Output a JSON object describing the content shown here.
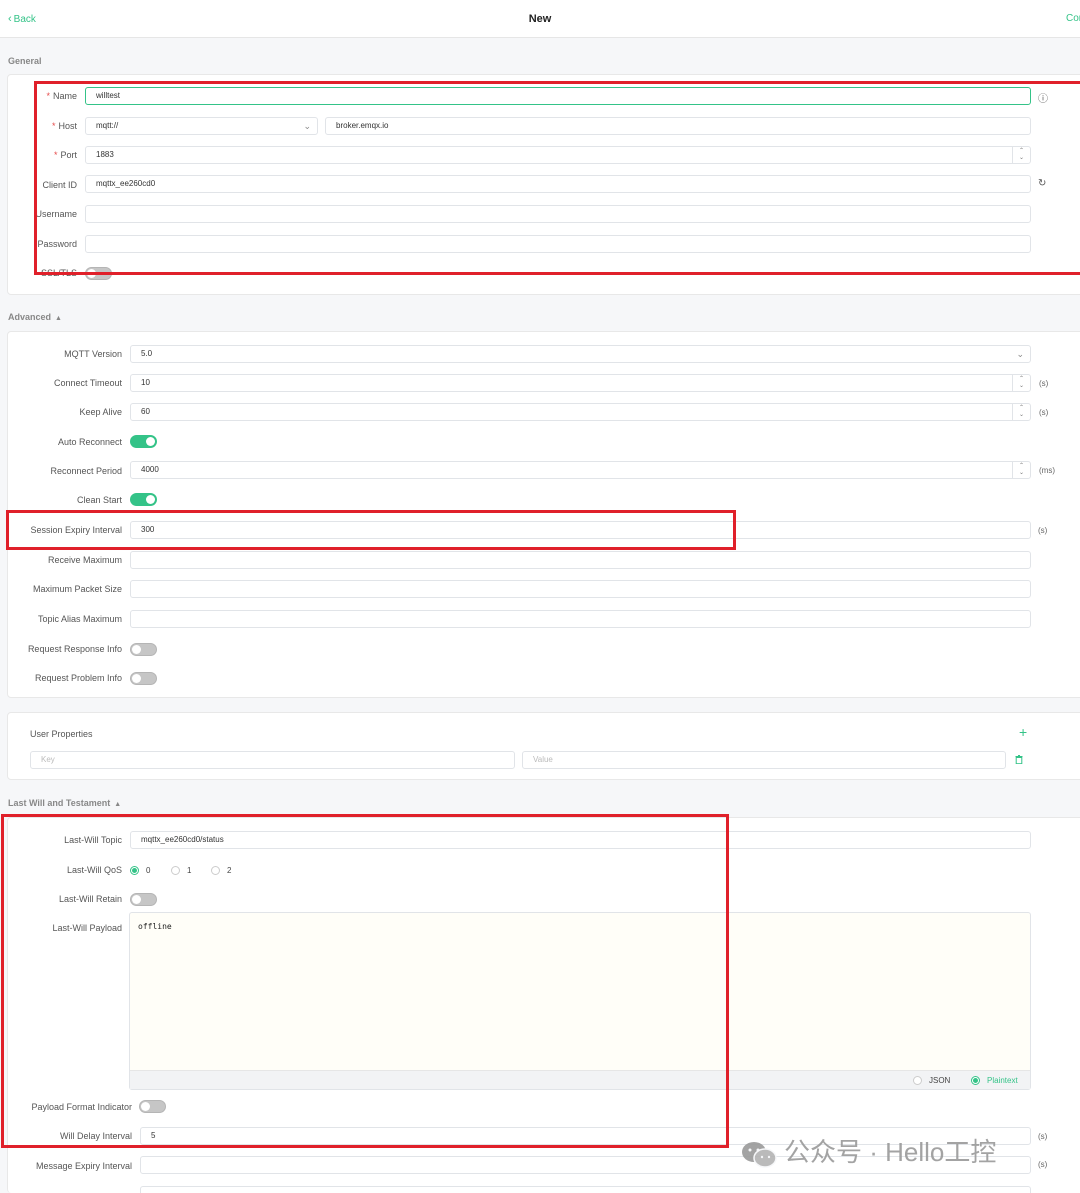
{
  "header": {
    "back_label": "Back",
    "title": "New",
    "connect_label": "Connect"
  },
  "sections": {
    "general": "General",
    "advanced": "Advanced",
    "last_will": "Last Will and Testament"
  },
  "general": {
    "name_label": "Name",
    "name_value": "willtest",
    "host_label": "Host",
    "host_protocol": "mqtt://",
    "host_value": "broker.emqx.io",
    "port_label": "Port",
    "port_value": "1883",
    "client_id_label": "Client ID",
    "client_id_value": "mqttx_ee260cd0",
    "username_label": "Username",
    "password_label": "Password",
    "ssl_label": "SSL/TLS",
    "ssl_on": false
  },
  "advanced": {
    "mqtt_version_label": "MQTT Version",
    "mqtt_version_value": "5.0",
    "connect_timeout_label": "Connect Timeout",
    "connect_timeout_value": "10",
    "connect_timeout_unit": "(s)",
    "keep_alive_label": "Keep Alive",
    "keep_alive_value": "60",
    "keep_alive_unit": "(s)",
    "auto_reconnect_label": "Auto Reconnect",
    "auto_reconnect_on": true,
    "reconnect_period_label": "Reconnect Period",
    "reconnect_period_value": "4000",
    "reconnect_period_unit": "(ms)",
    "clean_start_label": "Clean Start",
    "clean_start_on": true,
    "session_expiry_label": "Session Expiry Interval",
    "session_expiry_value": "300",
    "session_expiry_unit": "(s)",
    "receive_max_label": "Receive Maximum",
    "max_packet_label": "Maximum Packet Size",
    "topic_alias_label": "Topic Alias Maximum",
    "req_response_label": "Request Response Info",
    "req_response_on": false,
    "req_problem_label": "Request Problem Info",
    "req_problem_on": false
  },
  "user_properties": {
    "label": "User Properties",
    "key_placeholder": "Key",
    "value_placeholder": "Value"
  },
  "last_will": {
    "topic_label": "Last-Will Topic",
    "topic_value": "mqttx_ee260cd0/status",
    "qos_label": "Last-Will QoS",
    "qos_options": [
      "0",
      "1",
      "2"
    ],
    "qos_selected": "0",
    "retain_label": "Last-Will Retain",
    "retain_on": false,
    "payload_label": "Last-Will Payload",
    "payload_value": "offline",
    "format_json": "JSON",
    "format_plaintext": "Plaintext",
    "format_selected": "Plaintext",
    "payload_format_label": "Payload Format Indicator",
    "payload_format_on": false,
    "will_delay_label": "Will Delay Interval",
    "will_delay_value": "5",
    "will_delay_unit": "(s)",
    "message_expiry_label": "Message Expiry Interval",
    "message_expiry_unit": "(s)"
  },
  "watermark": {
    "text": "公众号 · Hello工控"
  },
  "colors": {
    "accent": "#34c388",
    "highlight": "#e0202a",
    "required": "#e64a4a"
  }
}
